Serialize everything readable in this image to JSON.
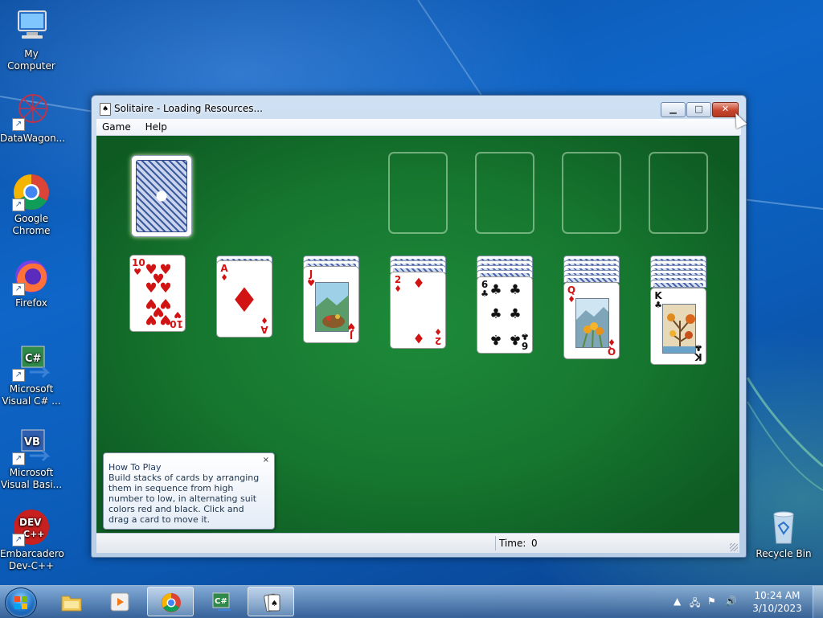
{
  "desktop": {
    "icons": [
      {
        "label": "My Computer"
      },
      {
        "label": "DataWagon..."
      },
      {
        "label": "Google Chrome"
      },
      {
        "label": "Firefox"
      },
      {
        "label": "Microsoft Visual C# ..."
      },
      {
        "label": "Microsoft Visual Basi..."
      },
      {
        "label": "Embarcadero Dev-C++"
      },
      {
        "label": "Recycle Bin"
      }
    ]
  },
  "window": {
    "title": "Solitaire - Loading Resources...",
    "menu": [
      "Game",
      "Help"
    ],
    "controls": {
      "minimize": "▁",
      "maximize": "□",
      "close": "✕"
    }
  },
  "game": {
    "tableau": [
      {
        "rank": "10",
        "suit": "♥",
        "color": "red",
        "hidden": 0
      },
      {
        "rank": "A",
        "suit": "♦",
        "color": "red",
        "hidden": 1
      },
      {
        "rank": "J",
        "suit": "♥",
        "color": "red",
        "hidden": 2
      },
      {
        "rank": "2",
        "suit": "♦",
        "color": "red",
        "hidden": 3
      },
      {
        "rank": "6",
        "suit": "♣",
        "color": "black",
        "hidden": 4
      },
      {
        "rank": "Q",
        "suit": "♦",
        "color": "red",
        "hidden": 5
      },
      {
        "rank": "K",
        "suit": "♣",
        "color": "black",
        "hidden": 6
      }
    ],
    "foundations": 4
  },
  "how_to_play": {
    "title": "How To Play",
    "body": "Build stacks of cards by arranging them in sequence from high number to low, in alternating suit colors red and black. Click and drag a card to move it.",
    "close": "×"
  },
  "status": {
    "time_label": "Time:",
    "time_value": "0"
  },
  "taskbar": {
    "clock_time": "10:24 AM",
    "clock_date": "3/10/2023"
  },
  "colors": {
    "felt": "#16772f",
    "red_suit": "#d21313",
    "black_suit": "#111111"
  }
}
